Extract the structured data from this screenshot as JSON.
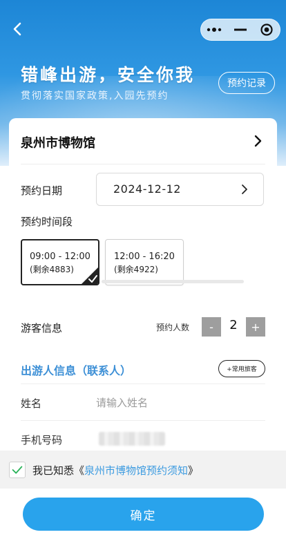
{
  "header": {
    "slogan": "错峰出游，安全你我",
    "subslogan": "贯彻落实国家政策,入园先预约",
    "records_label": "预约记录"
  },
  "venue": {
    "name": "泉州市博物馆"
  },
  "date": {
    "label": "预约日期",
    "value": "2024-12-12"
  },
  "slots": {
    "label": "预约时间段",
    "items": [
      {
        "time": "09:00 - 12:00",
        "remaining": "(剩余4883)",
        "selected": true
      },
      {
        "time": "12:00 - 16:20",
        "remaining": "(剩余4922)",
        "selected": false
      }
    ]
  },
  "visitor": {
    "label": "游客信息",
    "count_label": "预约人数",
    "count": "2",
    "minus": "-",
    "plus": "+"
  },
  "traveler": {
    "title": "出游人信息（联系人）",
    "frequent_label": "+常用旅客",
    "name_label": "姓名",
    "name_placeholder": "请输入姓名",
    "phone_label": "手机号码"
  },
  "agreement": {
    "prefix": "我已知悉《",
    "link": "泉州市博物馆预约须知",
    "suffix": "》"
  },
  "confirm_label": "确定",
  "colors": {
    "accent": "#29a3ec",
    "link": "#3c9be0",
    "title_blue": "#3c8fd6"
  }
}
